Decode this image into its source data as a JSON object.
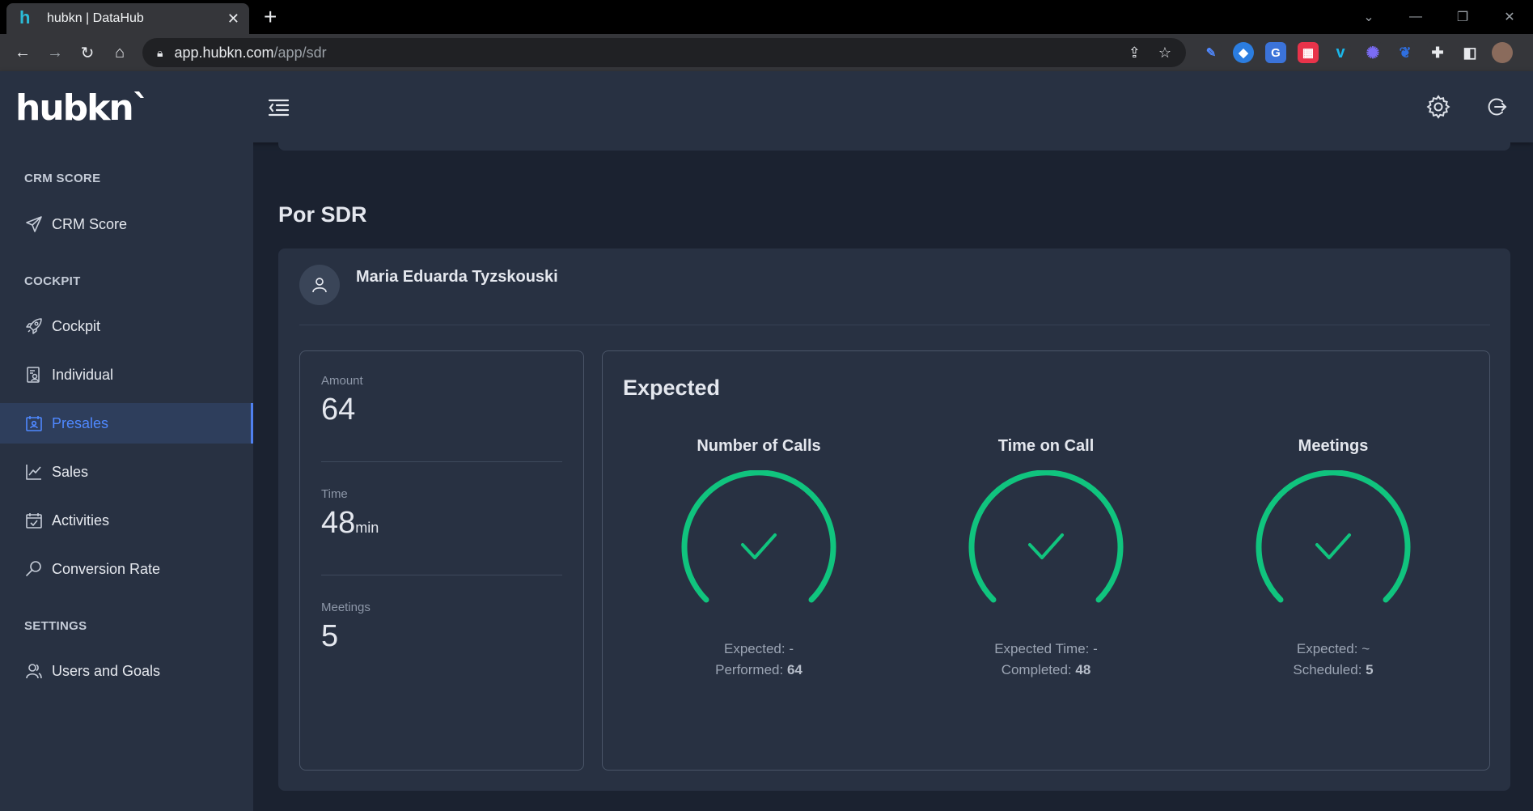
{
  "browser": {
    "tab_title": "hubkn | DataHub",
    "favicon_letter": "h",
    "url_host": "app.hubkn.com",
    "url_path": "/app/sdr"
  },
  "header": {
    "logo_text": "hubkn`"
  },
  "sidebar": {
    "sections": [
      {
        "title": "CRM SCORE"
      },
      {
        "title": "COCKPIT"
      },
      {
        "title": "SETTINGS"
      }
    ],
    "items": [
      {
        "label": "CRM Score",
        "icon": "send-icon"
      },
      {
        "label": "Cockpit",
        "icon": "rocket-icon"
      },
      {
        "label": "Individual",
        "icon": "person-report-icon"
      },
      {
        "label": "Presales",
        "icon": "calendar-person-icon",
        "active": true
      },
      {
        "label": "Sales",
        "icon": "line-chart-icon"
      },
      {
        "label": "Activities",
        "icon": "calendar-check-icon"
      },
      {
        "label": "Conversion Rate",
        "icon": "magnifier-icon"
      },
      {
        "label": "Users and Goals",
        "icon": "users-icon"
      }
    ]
  },
  "main": {
    "page_title": "Por SDR",
    "user_name": "Maria Eduarda Tyzskouski",
    "stats": [
      {
        "label": "Amount",
        "value": "64",
        "unit": ""
      },
      {
        "label": "Time",
        "value": "48",
        "unit": "min"
      },
      {
        "label": "Meetings",
        "value": "5",
        "unit": ""
      }
    ],
    "expected": {
      "title": "Expected",
      "gauges": [
        {
          "title": "Number of Calls",
          "line1_label": "Expected:",
          "line1_value": "-",
          "line2_label": "Performed:",
          "line2_value": "64"
        },
        {
          "title": "Time on Call",
          "line1_label": "Expected Time:",
          "line1_value": "-",
          "line2_label": "Completed:",
          "line2_value": "48"
        },
        {
          "title": "Meetings",
          "line1_label": "Expected:",
          "line1_value": "~",
          "line2_label": "Scheduled:",
          "line2_value": "5"
        }
      ]
    }
  },
  "colors": {
    "accent": "#4f88ff",
    "gauge_green": "#10c47e",
    "sidebar_bg": "#283142",
    "content_bg": "#1b2230"
  }
}
